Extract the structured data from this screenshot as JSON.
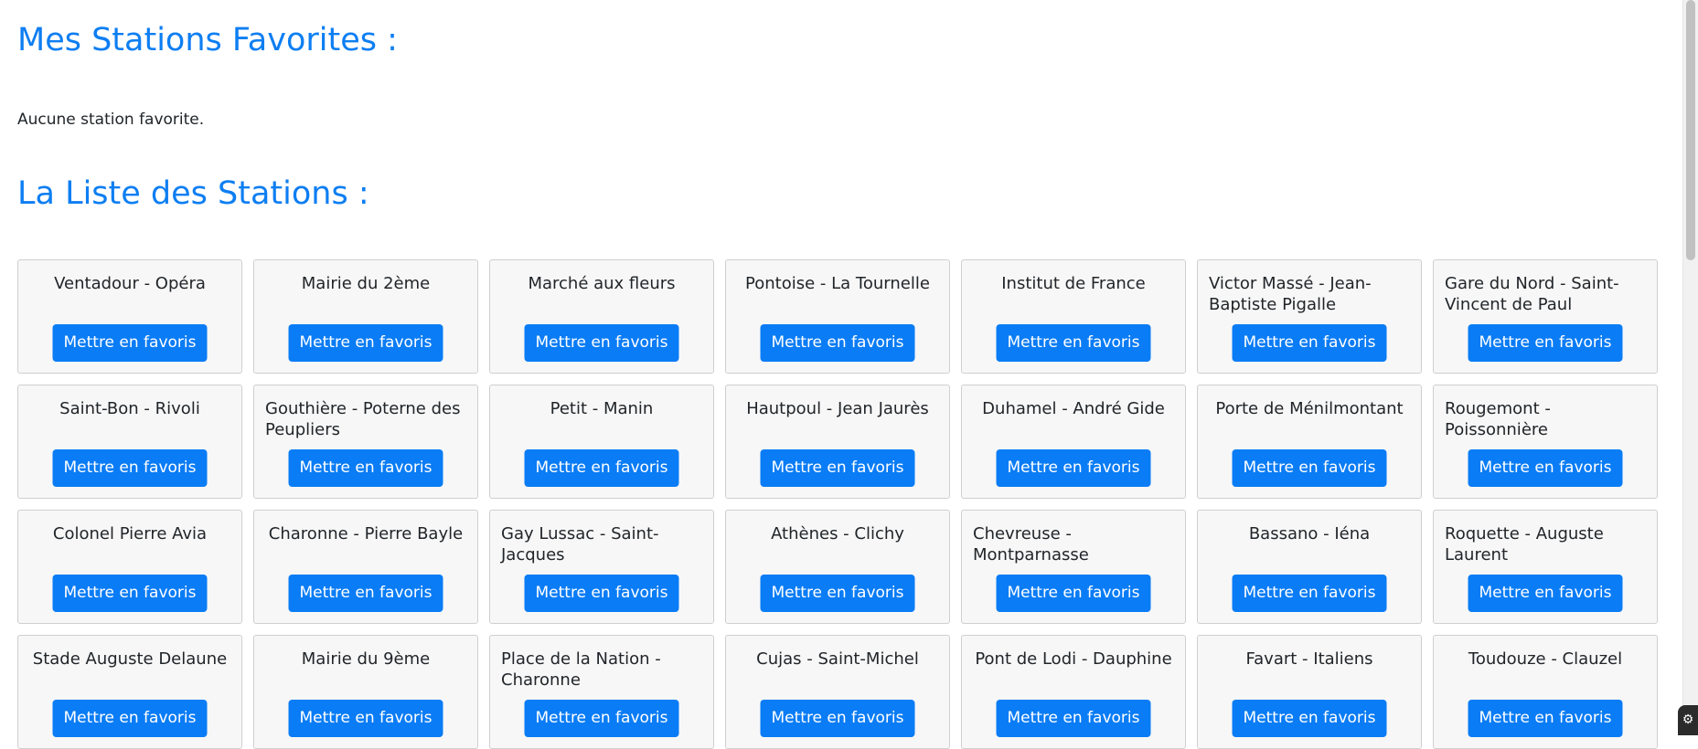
{
  "favorites": {
    "title": "Mes Stations Favorites :",
    "empty_message": "Aucune station favorite."
  },
  "station_list": {
    "title": "La Liste des Stations :",
    "button_label": "Mettre en favoris",
    "stations": [
      {
        "name": "Ventadour - Opéra",
        "wrap": false
      },
      {
        "name": "Mairie du 2ème",
        "wrap": false
      },
      {
        "name": "Marché aux fleurs",
        "wrap": false
      },
      {
        "name": "Pontoise - La Tournelle",
        "wrap": false
      },
      {
        "name": "Institut de France",
        "wrap": false
      },
      {
        "name": "Victor Massé - Jean-Baptiste Pigalle",
        "wrap": true
      },
      {
        "name": "Gare du Nord - Saint-Vincent de Paul",
        "wrap": true
      },
      {
        "name": "Saint-Bon - Rivoli",
        "wrap": false
      },
      {
        "name": "Gouthière - Poterne des Peupliers",
        "wrap": true
      },
      {
        "name": "Petit - Manin",
        "wrap": false
      },
      {
        "name": "Hautpoul - Jean Jaurès",
        "wrap": false
      },
      {
        "name": "Duhamel - André Gide",
        "wrap": false
      },
      {
        "name": "Porte de Ménilmontant",
        "wrap": false
      },
      {
        "name": "Rougemont - Poissonnière",
        "wrap": true
      },
      {
        "name": "Colonel Pierre Avia",
        "wrap": false
      },
      {
        "name": "Charonne - Pierre Bayle",
        "wrap": false
      },
      {
        "name": "Gay Lussac - Saint-Jacques",
        "wrap": true
      },
      {
        "name": "Athènes - Clichy",
        "wrap": false
      },
      {
        "name": "Chevreuse - Montparnasse",
        "wrap": true
      },
      {
        "name": "Bassano - Iéna",
        "wrap": false
      },
      {
        "name": "Roquette - Auguste Laurent",
        "wrap": true
      },
      {
        "name": "Stade Auguste Delaune",
        "wrap": false
      },
      {
        "name": "Mairie du 9ème",
        "wrap": false
      },
      {
        "name": "Place de la Nation - Charonne",
        "wrap": true
      },
      {
        "name": "Cujas - Saint-Michel",
        "wrap": false
      },
      {
        "name": "Pont de Lodi - Dauphine",
        "wrap": false
      },
      {
        "name": "Favart - Italiens",
        "wrap": false
      },
      {
        "name": "Toudouze - Clauzel",
        "wrap": false
      }
    ]
  },
  "colors": {
    "heading": "#0d7ef2",
    "button": "#0a7cf5",
    "card_background": "#f7f7f7",
    "card_border": "#cfcfcf"
  },
  "corner_widget": {
    "icon": "extension-icon"
  }
}
